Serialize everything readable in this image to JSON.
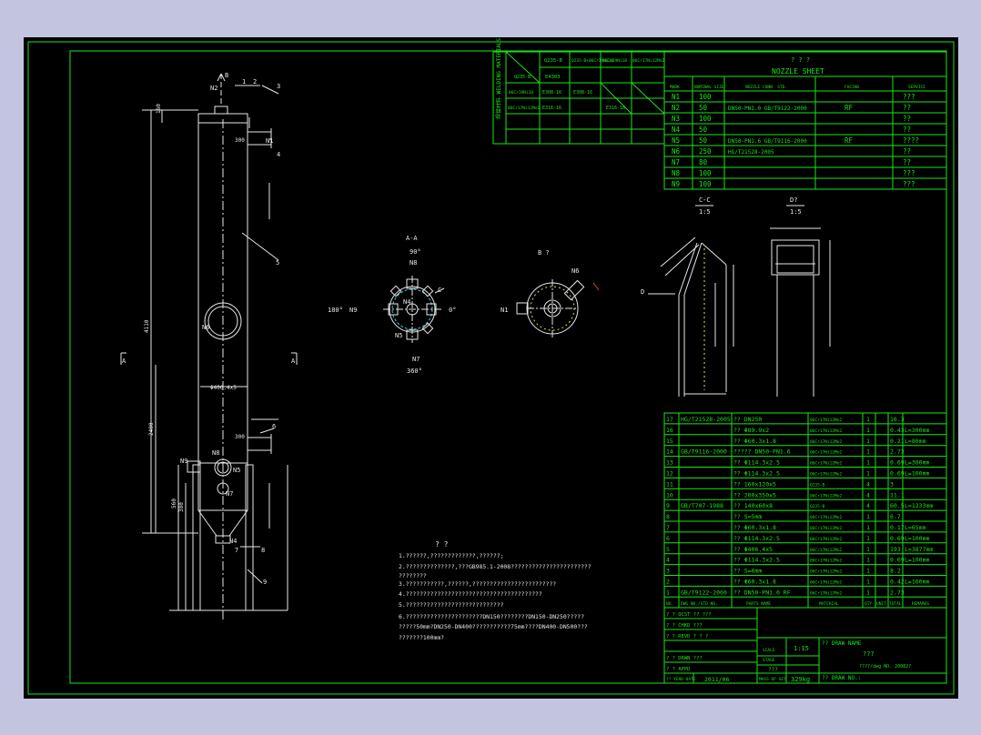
{
  "colors": {
    "background": "#c3c4e0",
    "canvas": "#000000",
    "frame": "#17e617",
    "drawing": "#e6e6e6"
  },
  "weld_table": {
    "side_label": "焊接材料 WELDING MATERIALS",
    "headers": [
      "Q235-B",
      "Q235-B+06Cr19Ni10",
      "06Cr19Ni10",
      "06Cr17Ni12Mo2"
    ],
    "rows": [
      [
        "Q235-B",
        "E4303",
        "",
        ""
      ],
      [
        "06Cr19Ni10",
        "E308-16",
        "E308-16",
        ""
      ],
      [
        "06Cr17Ni12Mo2",
        "E316-16",
        "",
        "E316-16"
      ],
      [
        "",
        "",
        "",
        ""
      ]
    ]
  },
  "nozzle": {
    "title": "? ? ?",
    "subtitle": "NOZZLE SHEET",
    "headers": [
      "MARK",
      "NOMINAL SIZE",
      "NOZZLE CONN. STD.",
      "FACING",
      "SERVICE"
    ],
    "rows": [
      [
        "N1",
        "100",
        "",
        "",
        "???"
      ],
      [
        "N2",
        "50",
        "DN50-PN1.0 GB/T9122-2000",
        "RF",
        "??"
      ],
      [
        "N3",
        "100",
        "",
        "",
        "??"
      ],
      [
        "N4",
        "50",
        "",
        "",
        "??"
      ],
      [
        "N5",
        "50",
        "DN50-PN1.6 GB/T9116-2000",
        "RF",
        "????"
      ],
      [
        "N6",
        "250",
        "HG/T21528-2005",
        "",
        "??"
      ],
      [
        "N7",
        "80",
        "",
        "",
        "??"
      ],
      [
        "N8",
        "100",
        "",
        "",
        "???"
      ],
      [
        "N9",
        "100",
        "",
        "",
        "???"
      ]
    ]
  },
  "views": {
    "aa": "A-A",
    "bb": "B ?",
    "cc": "C-C",
    "cc_scale": "1:5",
    "dd": "D?",
    "dd_scale": "1:5",
    "deg_90": "90°",
    "deg_180": "180°",
    "deg_0": "0°",
    "deg_360": "360°",
    "arrow_a": "A",
    "arrow_b": "B",
    "arrow_d": "D",
    "arrow_c": "C"
  },
  "main_labels": {
    "n2": "N2",
    "n1": "N1",
    "n6": "N6",
    "n8": "N8",
    "n9": "N9",
    "n5": "N5",
    "n7": "N7",
    "n4": "N4",
    "l1": "1",
    "l2": "2",
    "l3": "3",
    "l4": "4",
    "l5": "5",
    "l6": "6",
    "l7": "7",
    "l8": "8",
    "l9": "9",
    "shell": "Φ406.4x5",
    "d4110": "4110",
    "d2400": "2400",
    "d300a": "300",
    "d300b": "300",
    "d160": "160",
    "d560": "560",
    "d380": "380"
  },
  "notes": {
    "title": "?          ?",
    "lines": [
      "1.??????,?????????????,??????;",
      "2.??????????????,???GB985.1-2008???????????????????????",
      "   ????????",
      "3.???????????,??????,????????????????????????",
      "4.???????????????????????????????????????",
      "5.????????????????????????????",
      "6.??????????????????????DN150????????DN150-DN250?????",
      "   ?????50mm?DN250-DN400???????????75mm????DN400-DN500???",
      "   ???????100mm?"
    ]
  },
  "parts": {
    "headers": [
      "NO.",
      "DWG NO./STD NO.",
      "PARTS NAME",
      "MATERIAL",
      "QTY",
      "UNIT",
      "TOTAL",
      "REMARKS"
    ],
    "rows": [
      [
        "17",
        "HG/T21528-2005",
        "?? DN250",
        "06Cr17Ni12Mo2",
        "1",
        "16.3",
        ""
      ],
      [
        "16",
        "",
        "?? Φ89.9x2",
        "06Cr17Ni12Mo2",
        "1",
        "0.43",
        "L=300mm"
      ],
      [
        "15",
        "",
        "?? Φ60.3x1.8",
        "06Cr17Ni12Mo2",
        "1",
        "0.21",
        "L=80mm"
      ],
      [
        "14",
        "GB/T9116-2000",
        "????? DN50-PN1.6",
        "06Cr17Ni12Mo2",
        "1",
        "2.73",
        ""
      ],
      [
        "13",
        "",
        "?? Φ114.3x2.5",
        "06Cr17Ni12Mo2",
        "1",
        "0.69",
        "L=300mm"
      ],
      [
        "12",
        "",
        "?? Φ114.3x2.5",
        "06Cr17Ni12Mo2",
        "1",
        "0.69",
        "L=100mm"
      ],
      [
        "11",
        "",
        "?? 160x120x5",
        "Q235-B",
        "4",
        "3",
        ""
      ],
      [
        "10",
        "",
        "?? 200x350x5",
        "06Cr17Ni12Mo2",
        "4",
        "11.1",
        ""
      ],
      [
        "9",
        "GB/T707-1988",
        "?? 140x60x8",
        "Q235-B",
        "4",
        "60.5",
        "L=1233mm"
      ],
      [
        "8",
        "",
        "?? S=5mm",
        "06Cr17Ni12Mo2",
        "1",
        "6.7",
        ""
      ],
      [
        "7",
        "",
        "?? Φ60.3x1.8",
        "06Cr17Ni12Mo2",
        "1",
        "0.17",
        "L=65mm"
      ],
      [
        "6",
        "",
        "?? Φ114.3x2.5",
        "06Cr17Ni12Mo2",
        "1",
        "0.69",
        "L=100mm"
      ],
      [
        "5",
        "",
        "?? Φ406.4x5",
        "06Cr17Ni12Mo2",
        "1",
        "193",
        "L=3877mm"
      ],
      [
        "4",
        "",
        "?? Φ114.3x2.5",
        "06Cr17Ni12Mo2",
        "1",
        "0.69",
        "L=100mm"
      ],
      [
        "3",
        "",
        "?? S=6mm",
        "06Cr17Ni12Mo2",
        "1",
        "8.2",
        ""
      ],
      [
        "2",
        "",
        "?? Φ60.3x1.8",
        "06Cr17Ni12Mo2",
        "1",
        "0.42",
        "L=160mm"
      ],
      [
        "1",
        "GB/T9122-2000",
        "?? DN50-PN1.0 RF",
        "06Cr17Ni12Mo2",
        "1",
        "2.73",
        ""
      ]
    ]
  },
  "title_block": {
    "rows": [
      "?  ?  QCST ??  ???",
      "?  ?  CHKD ???",
      "?  ?  REVD ?  ?  ?",
      "?  ?  DRWN ???",
      "?  ?  APPD"
    ],
    "date_label": "?? YEAR DATE",
    "date": "2011/06",
    "scale_label": "SCALE",
    "scale": "1:15",
    "stage_label": "STAGE",
    "stage": "???",
    "mass_label": "MASS OF SET",
    "mass": "329kg",
    "name_label": "??  DRAW NAME",
    "name": "???",
    "sub_no": "????/dwg NO. 20082?",
    "dwg_label": "??  DRAW NO.:"
  }
}
